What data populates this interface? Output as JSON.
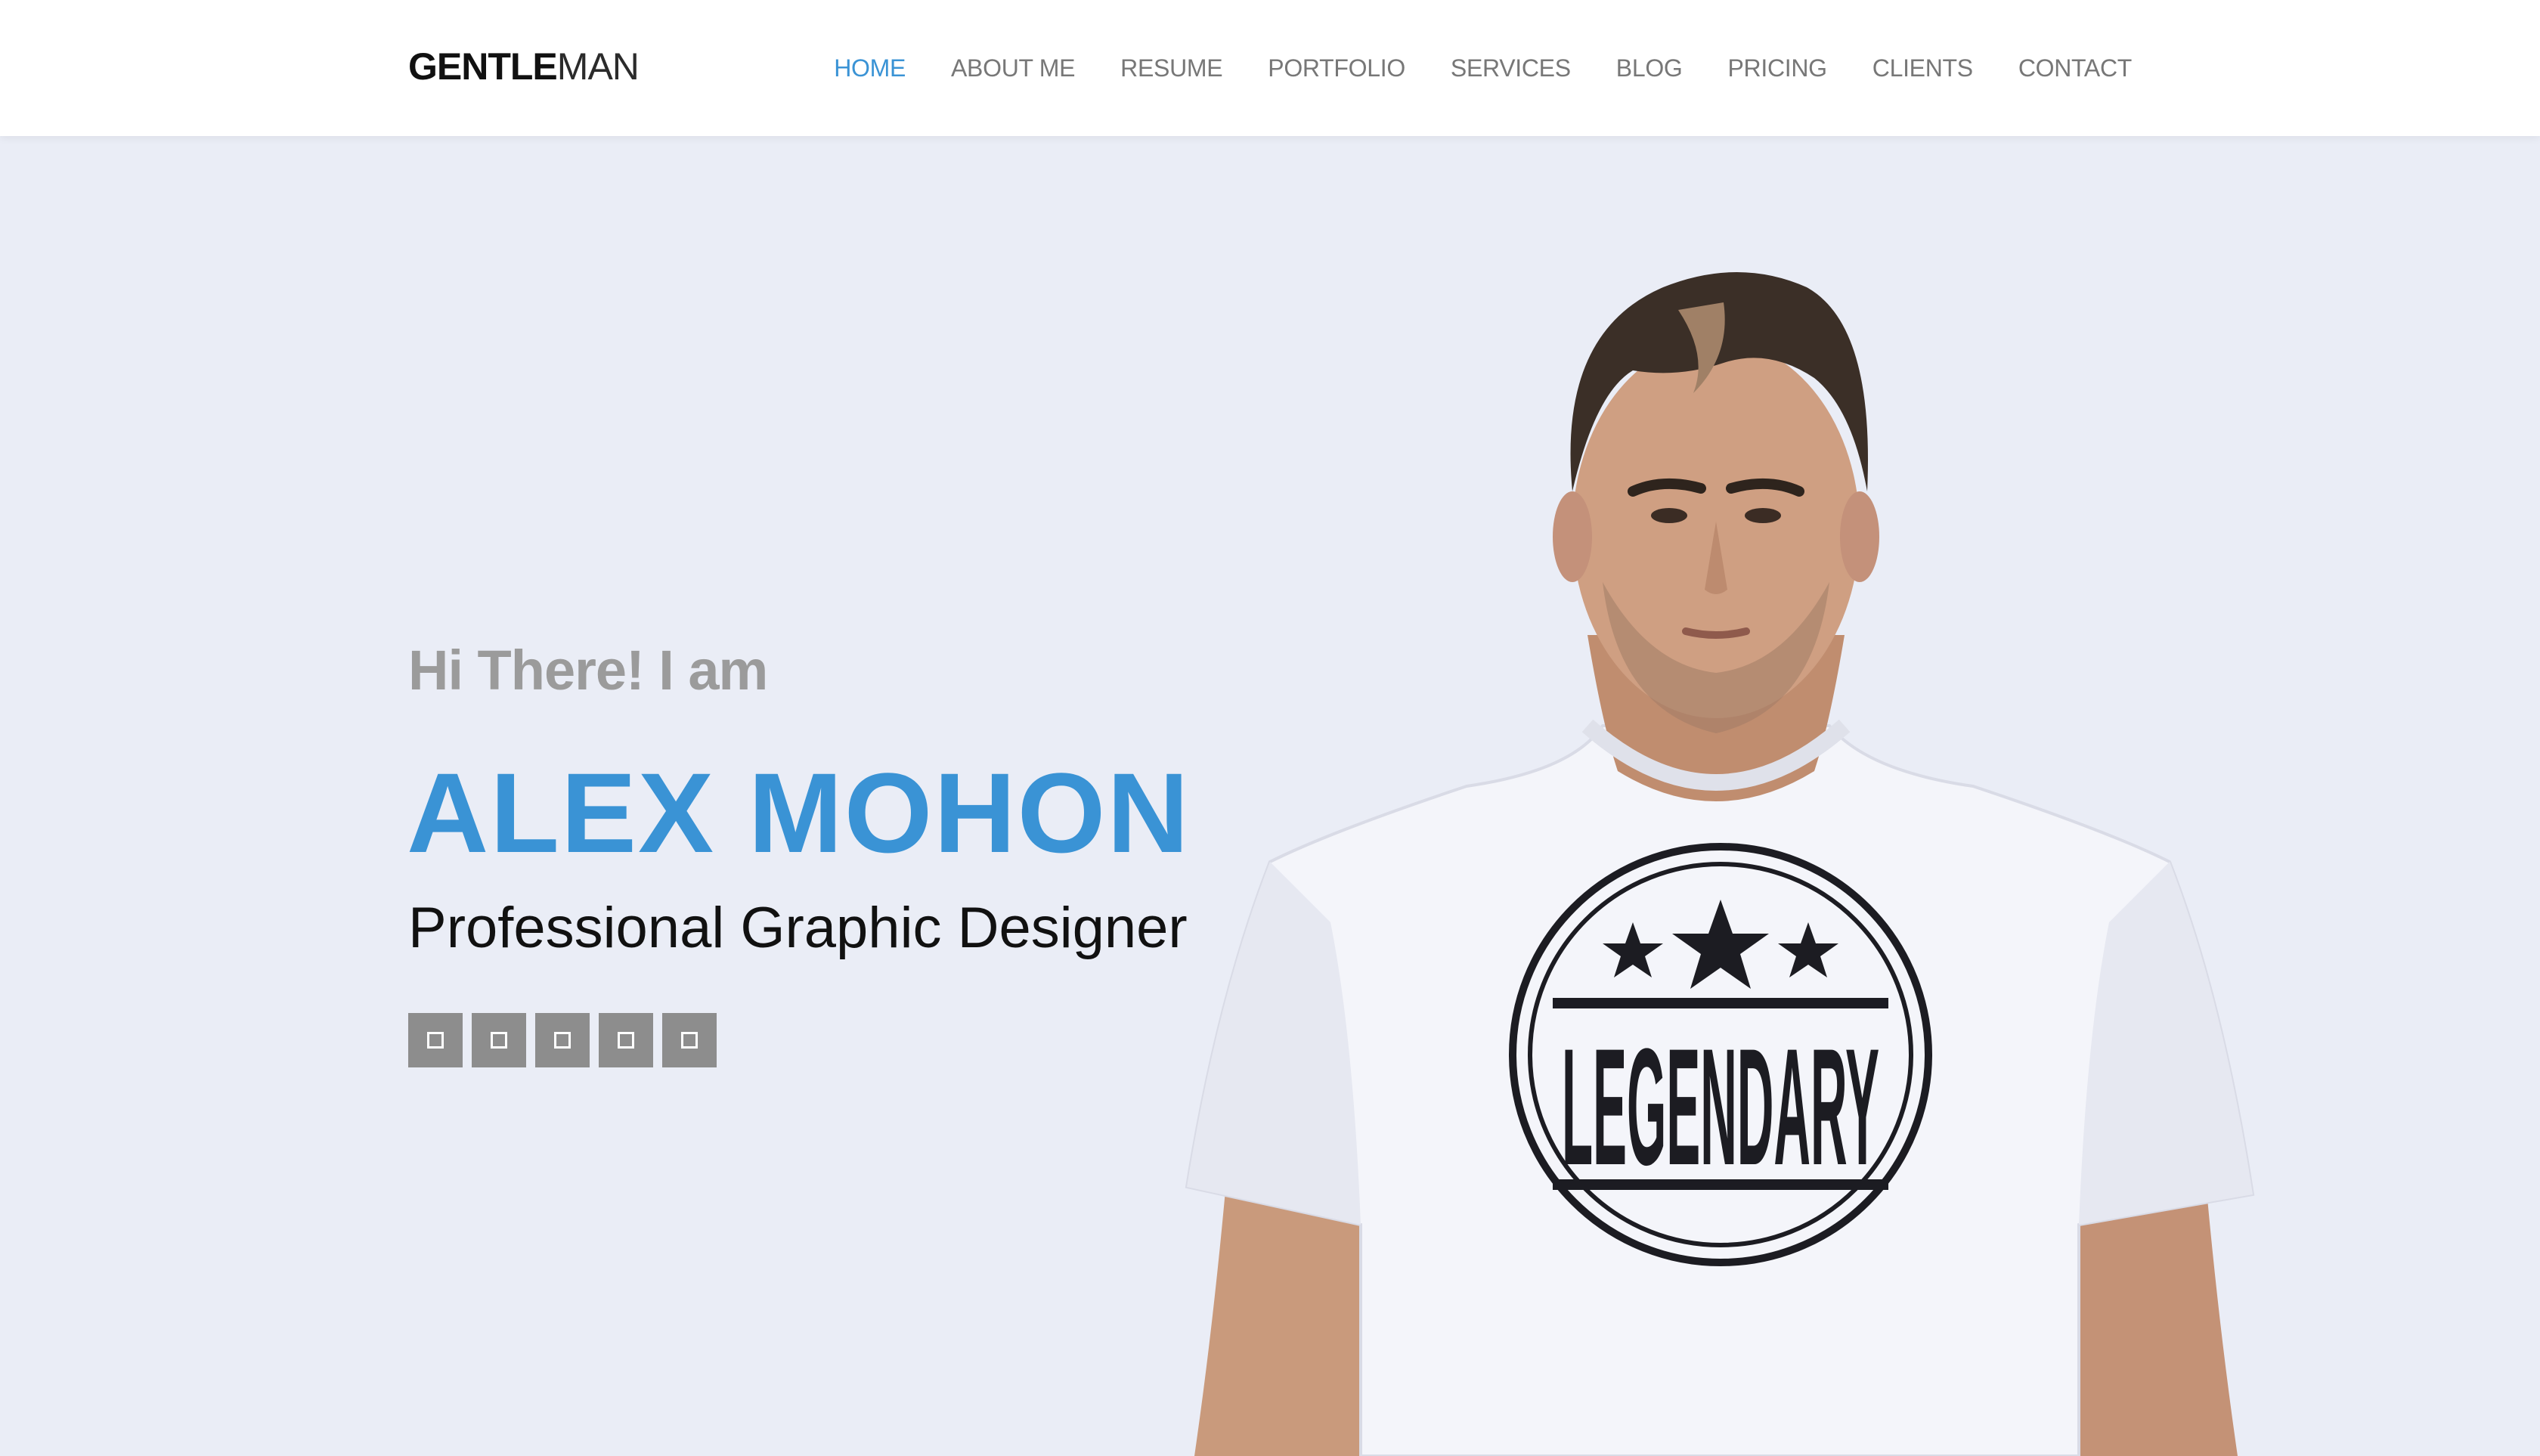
{
  "brand": {
    "bold": "GENTLE",
    "light": "MAN"
  },
  "nav": {
    "items": [
      {
        "label": "HOME",
        "active": true
      },
      {
        "label": "ABOUT ME"
      },
      {
        "label": "RESUME"
      },
      {
        "label": "PORTFOLIO"
      },
      {
        "label": "SERVICES"
      },
      {
        "label": "BLOG"
      },
      {
        "label": "PRICING"
      },
      {
        "label": "CLIENTS"
      },
      {
        "label": "CONTACT"
      }
    ]
  },
  "hero": {
    "intro": "Hi There! I am",
    "name": "ALEX MOHON",
    "role": "Professional Graphic Designer",
    "social_icons": [
      "social-icon-1",
      "social-icon-2",
      "social-icon-3",
      "social-icon-4",
      "social-icon-5"
    ],
    "shirt_print": "LEGENDARY"
  },
  "colors": {
    "accent": "#3a93d5",
    "hero_bg": "#eaedf6",
    "nav_text": "#777777",
    "intro_text": "#9b9b9b",
    "social_bg": "#8d8d8d"
  }
}
